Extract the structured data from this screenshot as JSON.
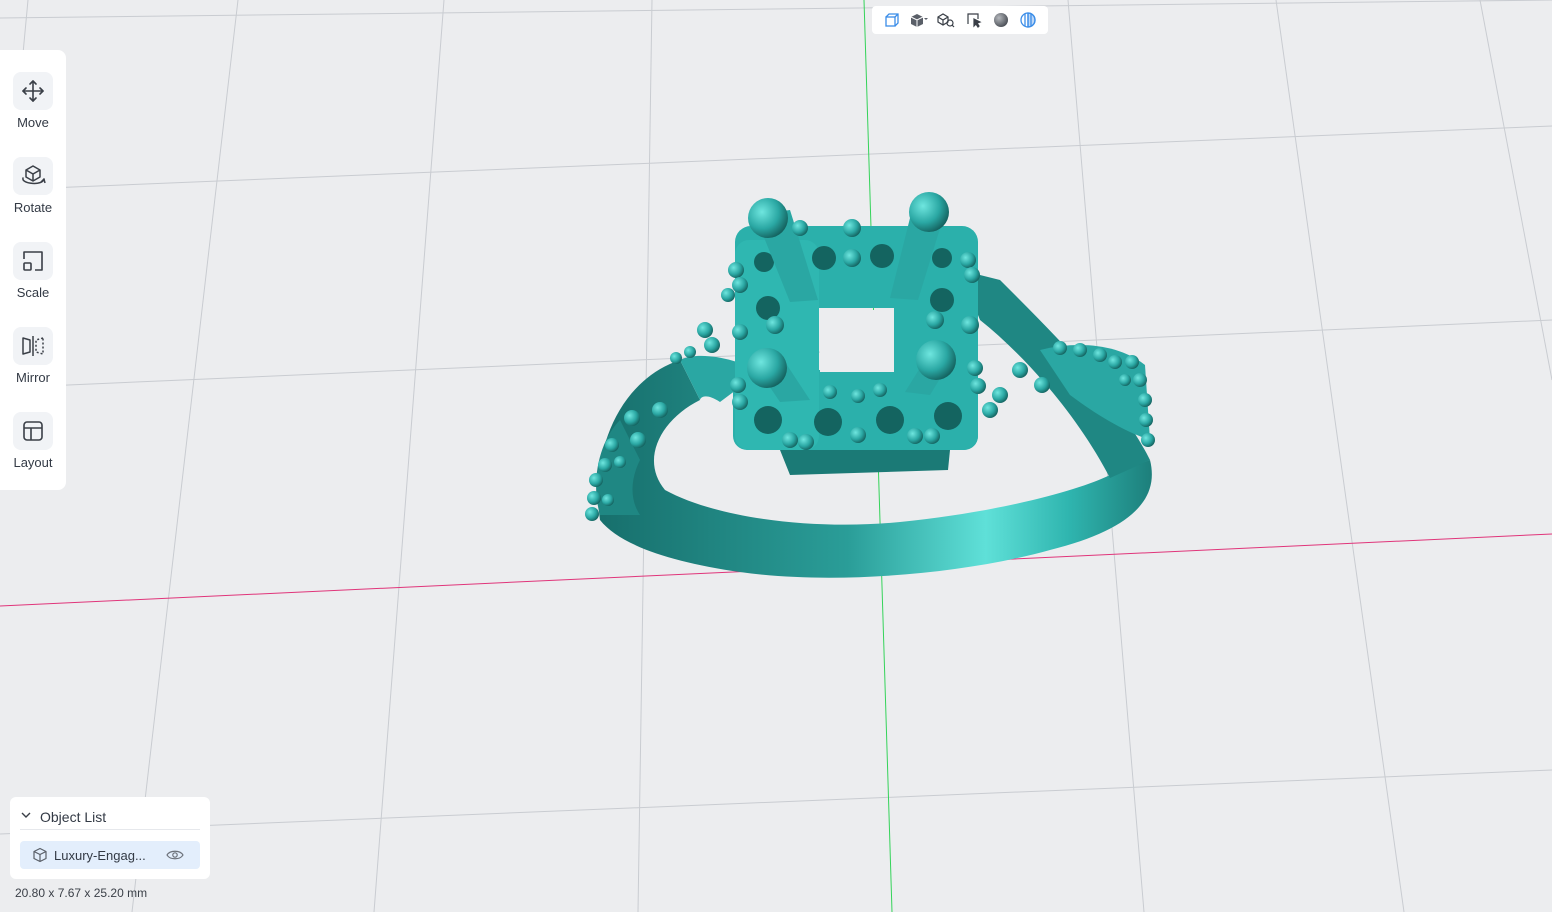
{
  "toolbar": {
    "tools": [
      {
        "label": "Move",
        "icon": "move-icon"
      },
      {
        "label": "Rotate",
        "icon": "rotate-icon"
      },
      {
        "label": "Scale",
        "icon": "scale-icon"
      },
      {
        "label": "Mirror",
        "icon": "mirror-icon"
      },
      {
        "label": "Layout",
        "icon": "layout-icon"
      }
    ]
  },
  "view_toolbar": {
    "buttons": [
      "perspective-cube-icon",
      "view-direction-icon",
      "zoom-fit-icon",
      "select-icon",
      "material-sphere-icon",
      "render-mode-icon"
    ]
  },
  "object_list": {
    "title": "Object List",
    "items": [
      {
        "name": "Luxury-Engag...",
        "visible": true
      }
    ]
  },
  "dimensions": "20.80 x 7.67 x 25.20 mm",
  "colors": {
    "background": "#ecedef",
    "model": "#2aa7a3",
    "x_axis": "#e0357a",
    "y_axis": "#35d35a",
    "accent": "#3b8de8"
  }
}
